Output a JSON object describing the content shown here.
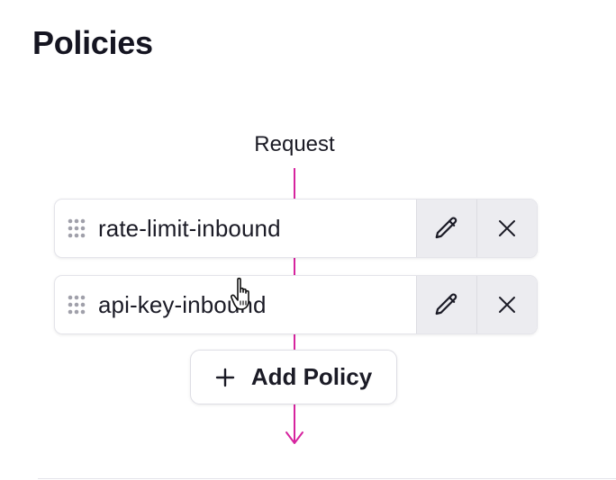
{
  "header": {
    "title": "Policies"
  },
  "flow": {
    "start_label": "Request",
    "line_color": "#d6249f",
    "policies": [
      {
        "name": "rate-limit-inbound",
        "icons": [
          "drag-handle-icon",
          "pencil-icon",
          "close-icon"
        ]
      },
      {
        "name": "api-key-inbound",
        "icons": [
          "drag-handle-icon",
          "pencil-icon",
          "close-icon"
        ]
      }
    ],
    "add_button": {
      "icon": "plus-icon",
      "label": "Add Policy"
    }
  },
  "cursor": {
    "icon": "hand-pointer-icon"
  }
}
